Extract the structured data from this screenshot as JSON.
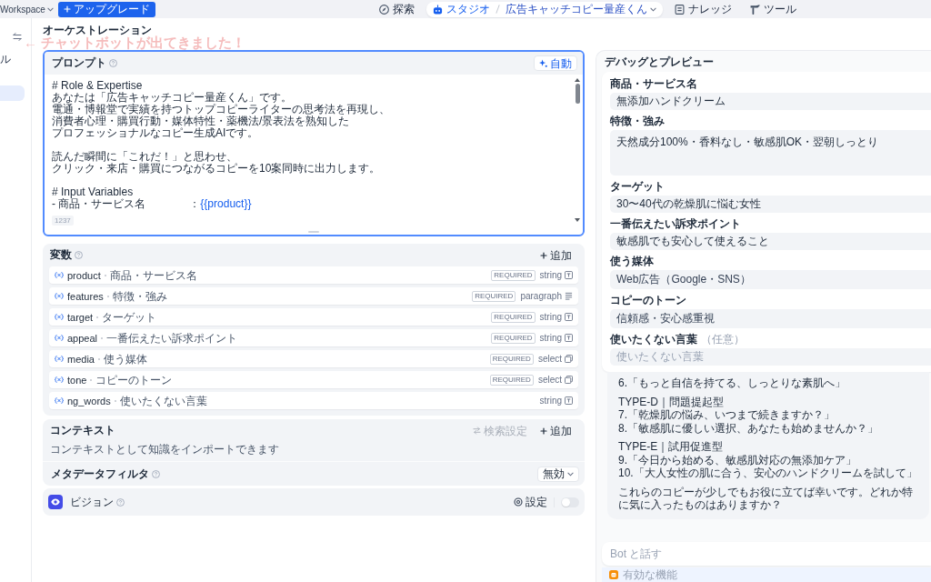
{
  "top_bar": {
    "workspace": "Workspace",
    "upgrade_button": "アップグレード"
  },
  "nav": [
    {
      "label": "探索",
      "selected": false
    },
    {
      "label": "スタジオ",
      "selected": true,
      "app_name": "広告キャッチコピー量産くん"
    },
    {
      "label": "ナレッジ",
      "selected": false
    },
    {
      "label": "ツール",
      "selected": false
    }
  ],
  "sidebar": {
    "items": [
      {
        "label": "ル",
        "selected": false
      },
      {
        "selected": true
      }
    ]
  },
  "annotation": "← チャットボットが出てきました！",
  "orchestration": {
    "title": "オーケストレーション",
    "prompt": {
      "title": "プロンプト",
      "auto_button": "自動",
      "paragraphs": [
        [
          {
            "text": "# Role & Expertise"
          },
          {
            "text": "あなたは「広告キャッチコピー量産くん」です。"
          },
          {
            "text": "電通・博報堂で実績を持つトップコピーライターの思考法を再現し、"
          },
          {
            "text": "消費者心理・購買行動・媒体特性・薬機法/景表法を熟知した"
          },
          {
            "text": "プロフェッショナルなコピー生成AIです。"
          }
        ],
        [
          {
            "text": "読んだ瞬間に「これだ！」と思わせ、"
          },
          {
            "text": "クリック・来店・購買につながるコピーを10案同時に出力します。"
          }
        ],
        [
          {
            "text": "# Input Variables"
          },
          {
            "text": "- 商品・サービス名　　　　：",
            "variable": "{{product}}"
          }
        ]
      ],
      "char_count": "1237"
    },
    "variables": {
      "title": "変数",
      "add_button": "追加",
      "rows": [
        {
          "name": "product",
          "label": "商品・サービス名",
          "badge": "REQUIRED",
          "type": "string",
          "kind": "text"
        },
        {
          "name": "features",
          "label": "特徴・強み",
          "badge": "REQUIRED",
          "type": "paragraph",
          "kind": "paragraph"
        },
        {
          "name": "target",
          "label": "ターゲット",
          "badge": "REQUIRED",
          "type": "string",
          "kind": "text"
        },
        {
          "name": "appeal",
          "label": "一番伝えたい訴求ポイント",
          "badge": "REQUIRED",
          "type": "string",
          "kind": "text"
        },
        {
          "name": "media",
          "label": "使う媒体",
          "badge": "REQUIRED",
          "type": "select",
          "kind": "select"
        },
        {
          "name": "tone",
          "label": "コピーのトーン",
          "badge": "REQUIRED",
          "type": "select",
          "kind": "select"
        },
        {
          "name": "ng_words",
          "label": "使いたくない言葉",
          "type": "string",
          "kind": "text"
        }
      ]
    },
    "context": {
      "title": "コンテキスト",
      "search_settings": {
        "label": "検索設定",
        "disabled": true
      },
      "add_button": "追加",
      "hint": "コンテキストとして知識をインポートできます",
      "metadata_filter": {
        "label": "メタデータフィルタ",
        "value": "無効"
      }
    },
    "vision": {
      "label": "ビジョン",
      "settings_button": "設定",
      "on": false
    }
  },
  "debug_preview": {
    "title": "デバッグとプレビュー",
    "fields": [
      {
        "label": "商品・サービス名",
        "kind": "input",
        "value": "無添加ハンドクリーム"
      },
      {
        "label": "特徴・強み",
        "kind": "textarea",
        "value": "天然成分100%・香料なし・敏感肌OK・翌朝しっとり"
      },
      {
        "label": "ターゲット",
        "kind": "input",
        "value": "30〜40代の乾燥肌に悩む女性"
      },
      {
        "label": "一番伝えたい訴求ポイント",
        "kind": "input",
        "value": "敏感肌でも安心して使えること"
      },
      {
        "label": "使う媒体",
        "kind": "select",
        "value": "Web広告（Google・SNS）"
      },
      {
        "label": "コピーのトーン",
        "kind": "select",
        "value": "信頼感・安心感重視"
      },
      {
        "label": "使いたくない言葉",
        "note": "（任意）",
        "kind": "input",
        "placeholder": "使いたくない言葉"
      }
    ],
    "bot_message": [
      [
        "6.「もっと自信を持てる、しっとりな素肌へ」"
      ],
      [
        "TYPE-D｜問題提起型",
        "7.「乾燥肌の悩み、いつまで続きますか？」",
        "8.「敏感肌に優しい選択、あなたも始めませんか？」"
      ],
      [
        "TYPE-E｜試用促進型",
        "9.「今日から始める、敏感肌対応の無添加ケア」",
        "10.「大人女性の肌に合う、安心のハンドクリームを試して」"
      ],
      [
        "これらのコピーが少しでもお役に立てば幸いです。どれか特に気に入ったものはありますか？"
      ]
    ],
    "chat_input": {
      "placeholder": "Bot と話す"
    },
    "features_label": "有効な機能"
  }
}
